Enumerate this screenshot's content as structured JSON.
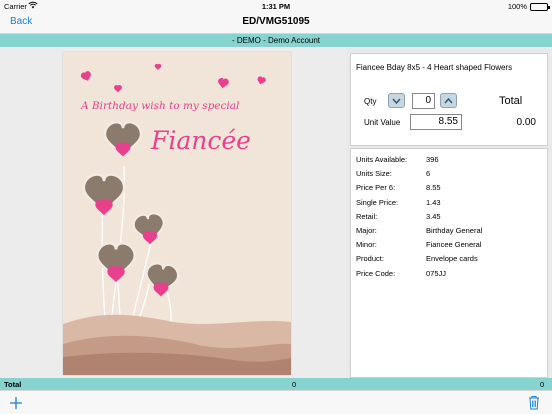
{
  "status": {
    "carrier": "Carrier",
    "time": "1:31 PM",
    "battery_text": "100%",
    "battery_level": 1.0
  },
  "nav": {
    "back_label": "Back",
    "title": "ED/VMG51095"
  },
  "account": {
    "label": "- DEMO - Demo Account"
  },
  "card": {
    "line1": "A Birthday wish to my special",
    "line2": "Fiancée",
    "colors": {
      "pink": "#e9408d",
      "heart": "#8b7b6c",
      "bg": "#f1e4d8"
    }
  },
  "order": {
    "product_name": "Fiancee Bday 8x5 - 4 Heart shaped Flowers",
    "qty_label": "Qty",
    "qty_value": "0",
    "unit_value_label": "Unit Value",
    "unit_value": "8.55",
    "total_label": "Total",
    "total_value": "0.00"
  },
  "details": {
    "rows": [
      {
        "label": "Units Available:",
        "value": "396"
      },
      {
        "label": "Units Size:",
        "value": "6"
      },
      {
        "label": "Price Per 6:",
        "value": "8.55"
      },
      {
        "label": "Single Price:",
        "value": "1.43"
      },
      {
        "label": "Retail:",
        "value": "3.45"
      },
      {
        "label": "Major:",
        "value": "Birthday General"
      },
      {
        "label": "Minor:",
        "value": "Fiancee General"
      },
      {
        "label": "Product:",
        "value": "Envelope cards"
      },
      {
        "label": "Price Code:",
        "value": "075JJ"
      }
    ]
  },
  "totals": {
    "label": "Total",
    "count": "0",
    "amount": "0"
  },
  "theme": {
    "accent": "#86d3cf",
    "link": "#1a7fd6"
  }
}
